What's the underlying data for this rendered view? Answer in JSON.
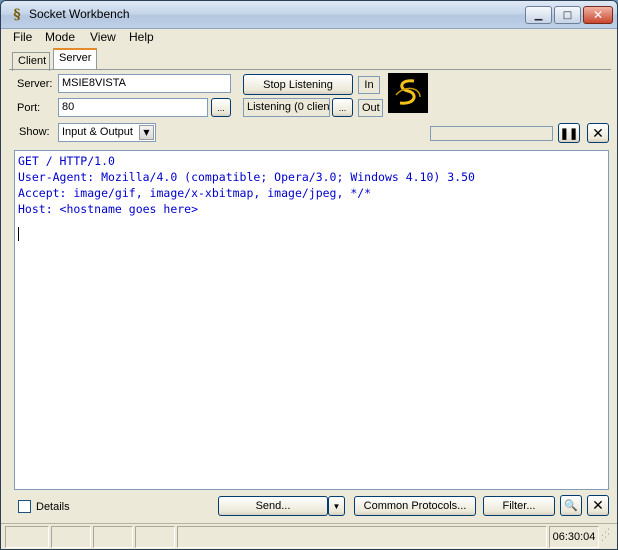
{
  "window": {
    "title": "Socket Workbench"
  },
  "menu": [
    "File",
    "Mode",
    "View",
    "Help"
  ],
  "tabs": {
    "client": "Client",
    "server": "Server"
  },
  "server_panel": {
    "server_label": "Server:",
    "server_value": "MSIE8VISTA",
    "port_label": "Port:",
    "port_value": "80",
    "browse_label": "...",
    "stop_button": "Stop Listening",
    "status_value": "Listening (0 clien",
    "status_more": "...",
    "in_label": "In",
    "out_label": "Out",
    "show_label": "Show:",
    "show_value": "Input & Output"
  },
  "console": {
    "lines": [
      "GET / HTTP/1.0",
      "User-Agent: Mozilla/4.0 (compatible; Opera/3.0; Windows 4.10) 3.50",
      "Accept: image/gif, image/x-xbitmap, image/jpeg, */*",
      "Host: <hostname goes here>"
    ],
    "text_color": "#0000cc"
  },
  "bottom": {
    "details_label": "Details",
    "send_button": "Send...",
    "protocols_button": "Common Protocols...",
    "filter_button": "Filter..."
  },
  "statusbar": {
    "time": "06:30:04"
  },
  "colors": {
    "accent": "#e68b2c",
    "border": "#7f9db9"
  }
}
